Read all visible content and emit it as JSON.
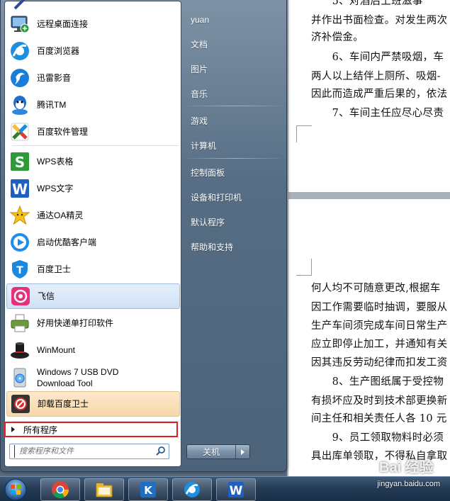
{
  "start_menu": {
    "programs": [
      {
        "label": "远程桌面连接",
        "icon": "remote-desktop-icon"
      },
      {
        "label": "百度浏览器",
        "icon": "baidu-browser-icon"
      },
      {
        "label": "迅雷影音",
        "icon": "xunlei-player-icon"
      },
      {
        "label": "腾讯TM",
        "icon": "tencent-tm-icon"
      },
      {
        "label": "百度软件管理",
        "icon": "baidu-software-manager-icon"
      },
      {
        "label": "WPS表格",
        "icon": "wps-spreadsheet-icon"
      },
      {
        "label": "WPS文字",
        "icon": "wps-writer-icon"
      },
      {
        "label": "通达OA精灵",
        "icon": "tongda-oa-icon"
      },
      {
        "label": "启动优酷客户端",
        "icon": "youku-icon"
      },
      {
        "label": "百度卫士",
        "icon": "baidu-guard-icon"
      },
      {
        "label": "飞信",
        "icon": "fetion-icon"
      },
      {
        "label": "好用快递单打印软件",
        "icon": "printer-icon"
      },
      {
        "label": "WinMount",
        "icon": "winmount-icon"
      },
      {
        "label": "Windows 7 USB DVD Download Tool",
        "icon": "usb-dvd-tool-icon"
      },
      {
        "label": "卸载百度卫士",
        "icon": "uninstall-icon"
      }
    ],
    "all_programs_label": "所有程序",
    "search_placeholder": "搜索程序和文件",
    "right_items": [
      {
        "label": "yuan"
      },
      {
        "label": "文档"
      },
      {
        "label": "图片"
      },
      {
        "label": "音乐"
      },
      {
        "label": "游戏"
      },
      {
        "label": "计算机"
      },
      {
        "label": "控制面板"
      },
      {
        "label": "设备和打印机"
      },
      {
        "label": "默认程序"
      },
      {
        "label": "帮助和支持"
      }
    ],
    "shutdown_label": "关机"
  },
  "document": {
    "page1_lines": [
      "并作出书面检查。对发生两次",
      "济补偿金。",
      "　　6、车间内严禁吸烟，车",
      "两人以上结伴上厕所、吸烟-",
      "因此而造成严重后果的，依法",
      "　　7、车间主任应尽心尽责"
    ],
    "page2_lines": [
      "何人均不可随意更改,根据车",
      "因工作需要临时抽调，要服从",
      "生产车间须完成车间日常生产",
      "应立即停止加工，并通知有关",
      "因其违反劳动纪律而扣发工资",
      "　　8、生产图纸属于受控物",
      "有损坏应及时到技术部更换新",
      "间主任和相关责任人各 10 元",
      "　　9、员工领取物料时必须",
      "具出库单领取，不得私自拿取"
    ]
  },
  "taskbar": {
    "buttons": [
      {
        "icon": "chrome-icon"
      },
      {
        "icon": "file-explorer-icon"
      },
      {
        "icon": "kk-app-icon"
      },
      {
        "icon": "baidu-browser-icon"
      },
      {
        "icon": "wps-writer-icon"
      }
    ]
  },
  "watermark": {
    "logo_text": "Bai 经验",
    "url": "jingyan.baidu.com"
  },
  "colors": {
    "highlight_red": "#e21e1e",
    "menu_blue": "#566d84",
    "taskbar": "#233a55"
  }
}
